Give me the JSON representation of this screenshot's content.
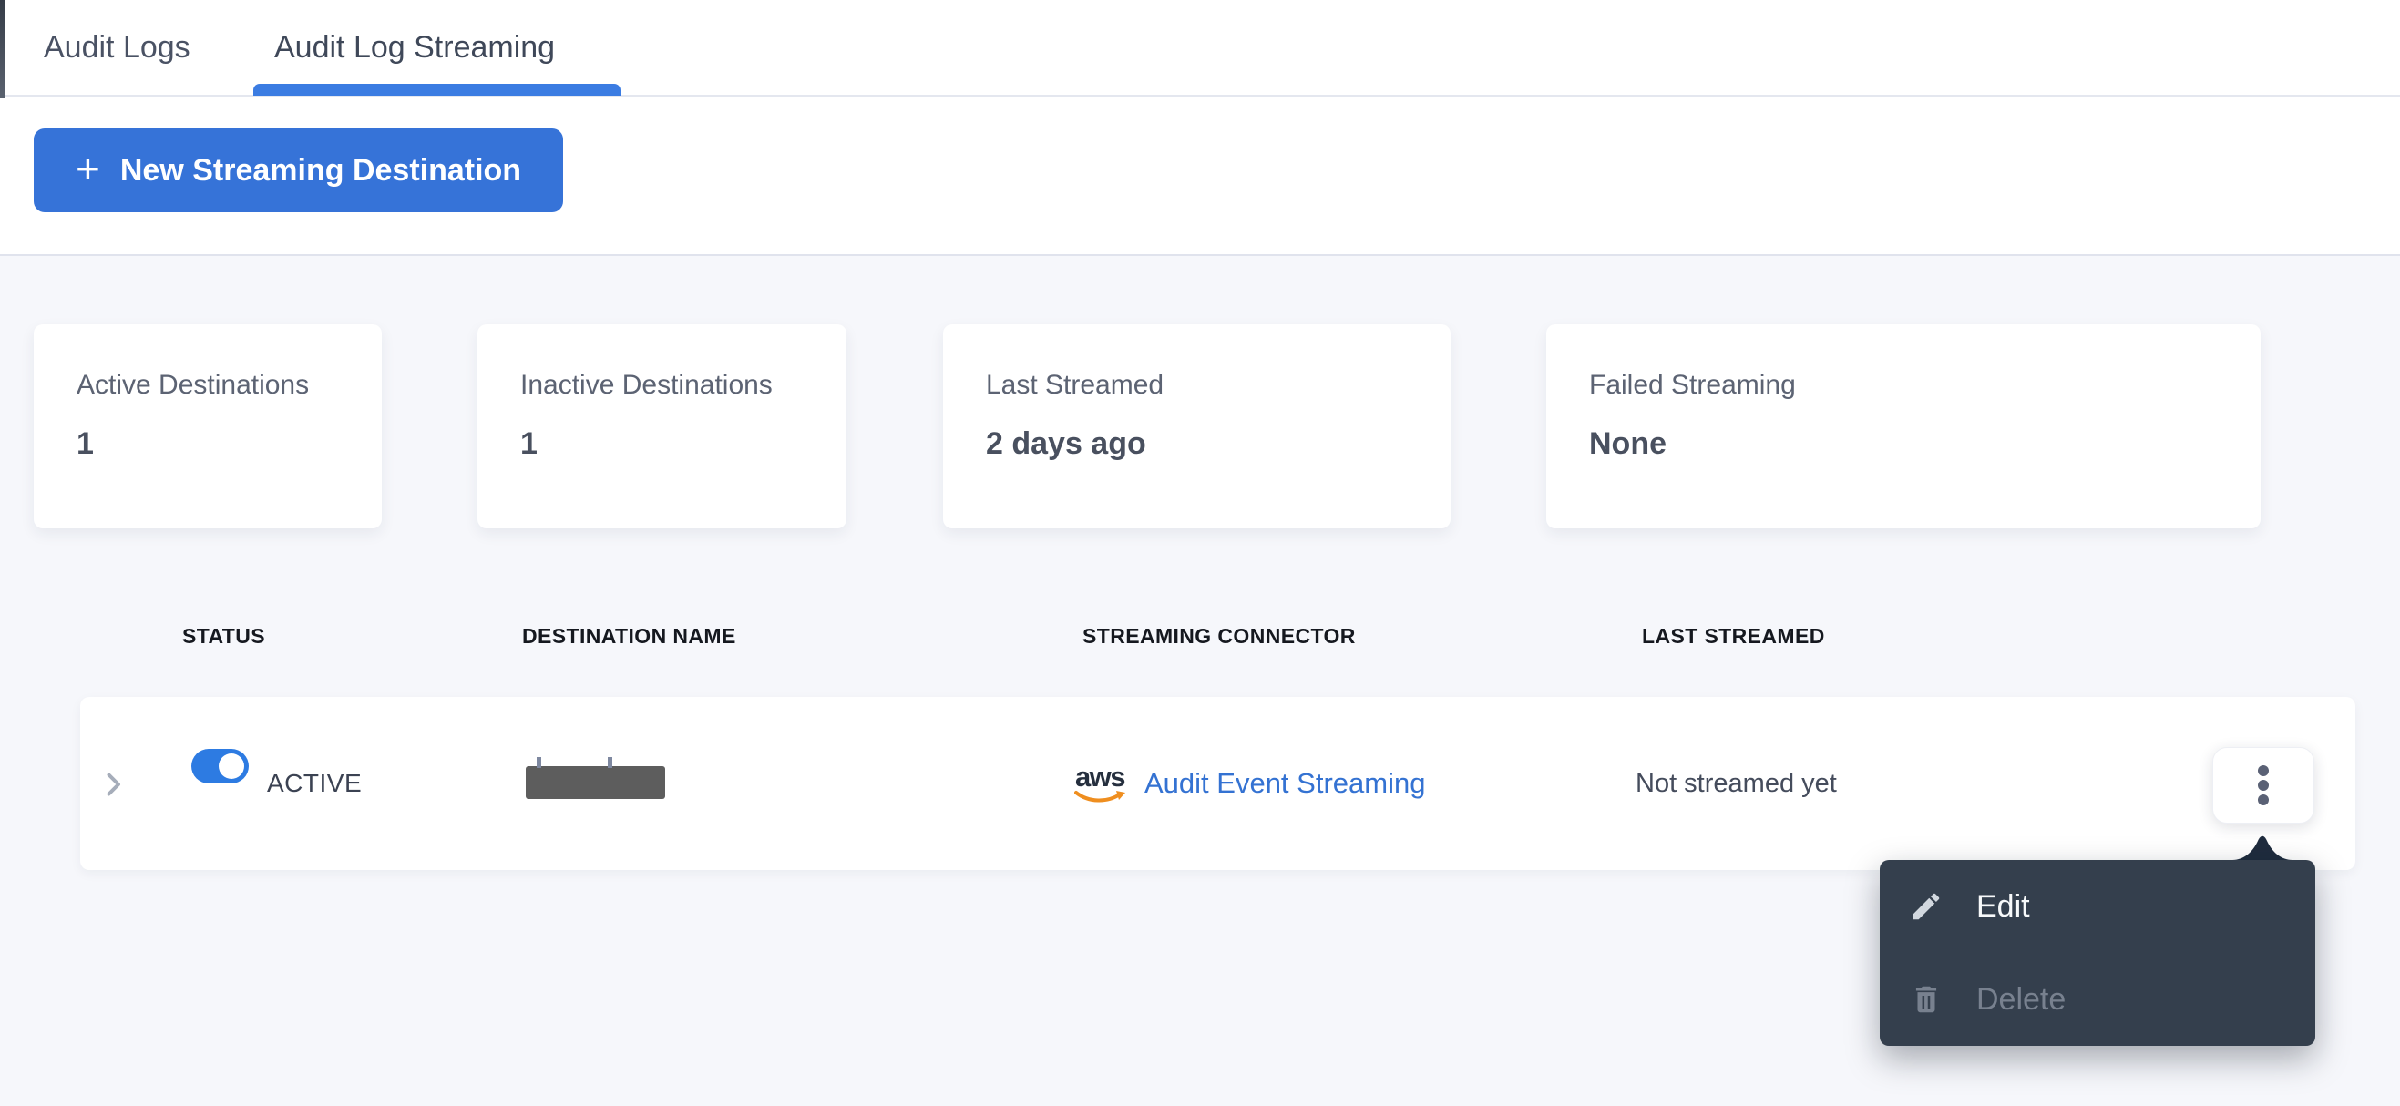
{
  "tabs": {
    "items": [
      {
        "label": "Audit Logs",
        "active": false
      },
      {
        "label": "Audit Log Streaming",
        "active": true
      }
    ]
  },
  "toolbar": {
    "plus_icon": "+",
    "new_destination_button": "New Streaming Destination"
  },
  "stats": {
    "cards": [
      {
        "label": "Active Destinations",
        "value": "1"
      },
      {
        "label": "Inactive Destinations",
        "value": "1"
      },
      {
        "label": "Last Streamed",
        "value": "2 days ago"
      },
      {
        "label": "Failed Streaming",
        "value": "None"
      }
    ]
  },
  "table": {
    "headers": [
      "STATUS",
      "DESTINATION NAME",
      "STREAMING CONNECTOR",
      "LAST STREAMED"
    ],
    "row": {
      "status_toggle": "on",
      "status_label": "ACTIVE",
      "destination_name_redacted": true,
      "connector_provider": "aws",
      "connector_label": "Audit Event Streaming",
      "last_streamed": "Not streamed yet"
    }
  },
  "context_menu": {
    "items": [
      {
        "label": "Edit",
        "icon": "pencil-icon",
        "enabled": true
      },
      {
        "label": "Delete",
        "icon": "trash-icon",
        "enabled": false
      }
    ]
  },
  "colors": {
    "accent_blue": "#3673d8",
    "link_blue": "#3472d2",
    "toggle_blue": "#2d7be2",
    "tab_underline_blue": "#3b7ce2",
    "menu_bg": "#343f4d",
    "menu_caret": "#1f2c3e",
    "aws_orange": "#ef8e1f",
    "redaction_gray": "#5d5d5d",
    "page_bg": "#f6f7fb"
  }
}
